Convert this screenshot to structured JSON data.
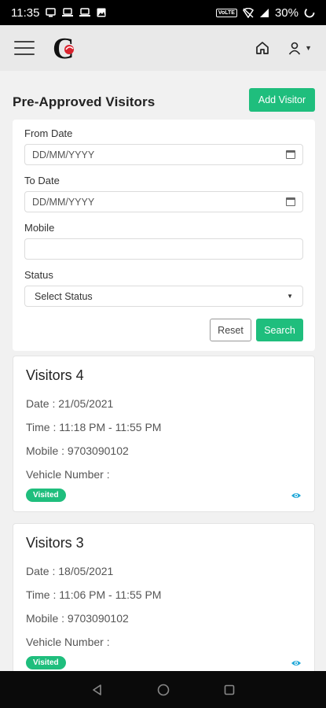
{
  "status_bar": {
    "time": "11:35",
    "network": "VoLTE",
    "battery": "30%"
  },
  "app_bar": {
    "menu_icon": "hamburger-icon",
    "logo_letter": "C",
    "home_icon": "home-icon",
    "user_icon": "user-icon"
  },
  "page": {
    "title": "Pre-Approved Visitors",
    "add_button": "Add Visitor"
  },
  "filters": {
    "from_date_label": "From Date",
    "from_date_placeholder": "DD/MM/YYYY",
    "to_date_label": "To Date",
    "to_date_placeholder": "DD/MM/YYYY",
    "mobile_label": "Mobile",
    "mobile_value": "",
    "status_label": "Status",
    "status_selected": "Select Status",
    "reset_button": "Reset",
    "search_button": "Search"
  },
  "visitors": [
    {
      "title": "Visitors 4",
      "date": "Date : 21/05/2021",
      "time": "Time : 11:18 PM - 11:55 PM",
      "mobile": "Mobile : 9703090102",
      "vehicle": "Vehicle Number :",
      "status": "Visited"
    },
    {
      "title": "Visitors 3",
      "date": "Date : 18/05/2021",
      "time": "Time : 11:06 PM - 11:55 PM",
      "mobile": "Mobile : 9703090102",
      "vehicle": "Vehicle Number :",
      "status": "Visited"
    }
  ],
  "colors": {
    "accent": "#1fbe7d",
    "logo_red": "#d9232e"
  }
}
